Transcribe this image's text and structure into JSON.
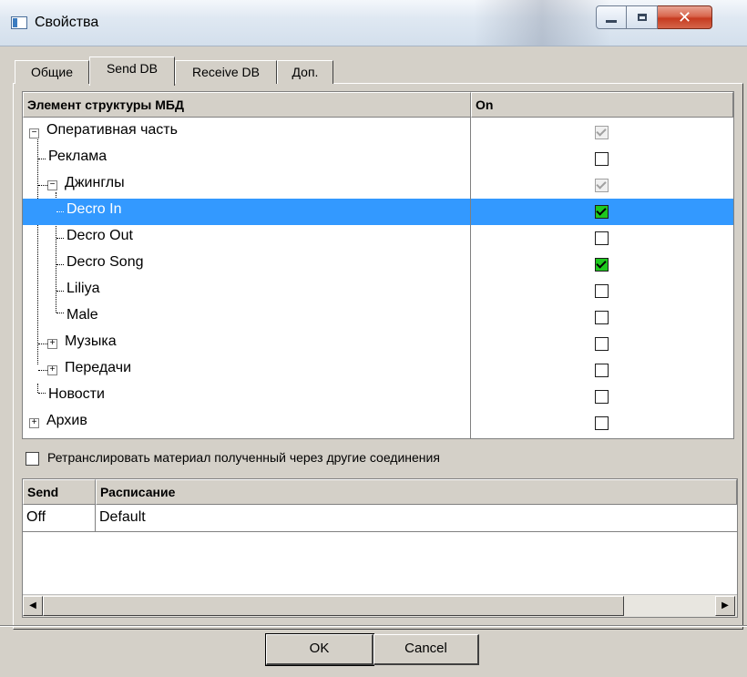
{
  "window": {
    "title": "Свойства"
  },
  "tabs": [
    {
      "label": "Общие",
      "active": false
    },
    {
      "label": "Send DB",
      "active": true
    },
    {
      "label": "Receive DB",
      "active": false
    },
    {
      "label": "Доп.",
      "active": false
    }
  ],
  "structure_grid": {
    "columns": [
      "Элемент структуры МБД",
      "On"
    ],
    "rows": [
      {
        "label": "Оперативная часть",
        "level": 0,
        "expander": "minus",
        "check": "grey"
      },
      {
        "label": "Реклама",
        "level": 1,
        "expander": "none",
        "check": "empty"
      },
      {
        "label": "Джинглы",
        "level": 1,
        "expander": "minus",
        "check": "grey"
      },
      {
        "label": "Decro In",
        "level": 2,
        "expander": "none",
        "check": "green",
        "selected": true
      },
      {
        "label": "Decro Out",
        "level": 2,
        "expander": "none",
        "check": "empty"
      },
      {
        "label": "Decro Song",
        "level": 2,
        "expander": "none",
        "check": "green"
      },
      {
        "label": "Liliya",
        "level": 2,
        "expander": "none",
        "check": "empty"
      },
      {
        "label": "Male",
        "level": 2,
        "expander": "none",
        "check": "empty"
      },
      {
        "label": "Музыка",
        "level": 1,
        "expander": "plus",
        "check": "empty"
      },
      {
        "label": "Передачи",
        "level": 1,
        "expander": "plus",
        "check": "empty"
      },
      {
        "label": "Новости",
        "level": 1,
        "expander": "none",
        "check": "empty"
      },
      {
        "label": "Архив",
        "level": 0,
        "expander": "plus",
        "check": "empty"
      }
    ]
  },
  "retranslate": {
    "label": "Ретранслировать материал полученный через другие соединения",
    "checked": false
  },
  "schedule_grid": {
    "columns": [
      "Send",
      "Расписание"
    ],
    "rows": [
      {
        "send": "Off",
        "schedule": "Default"
      }
    ]
  },
  "buttons": {
    "ok": "OK",
    "cancel": "Cancel"
  },
  "icons": {
    "min": "minimize-icon",
    "max": "maximize-icon",
    "close": "close-icon",
    "scroll_left": "arrow-left-icon",
    "scroll_right": "arrow-right-icon"
  },
  "colors": {
    "selection": "#3399ff",
    "check_green": "#1ec81e",
    "dialog": "#d4d0c8"
  }
}
